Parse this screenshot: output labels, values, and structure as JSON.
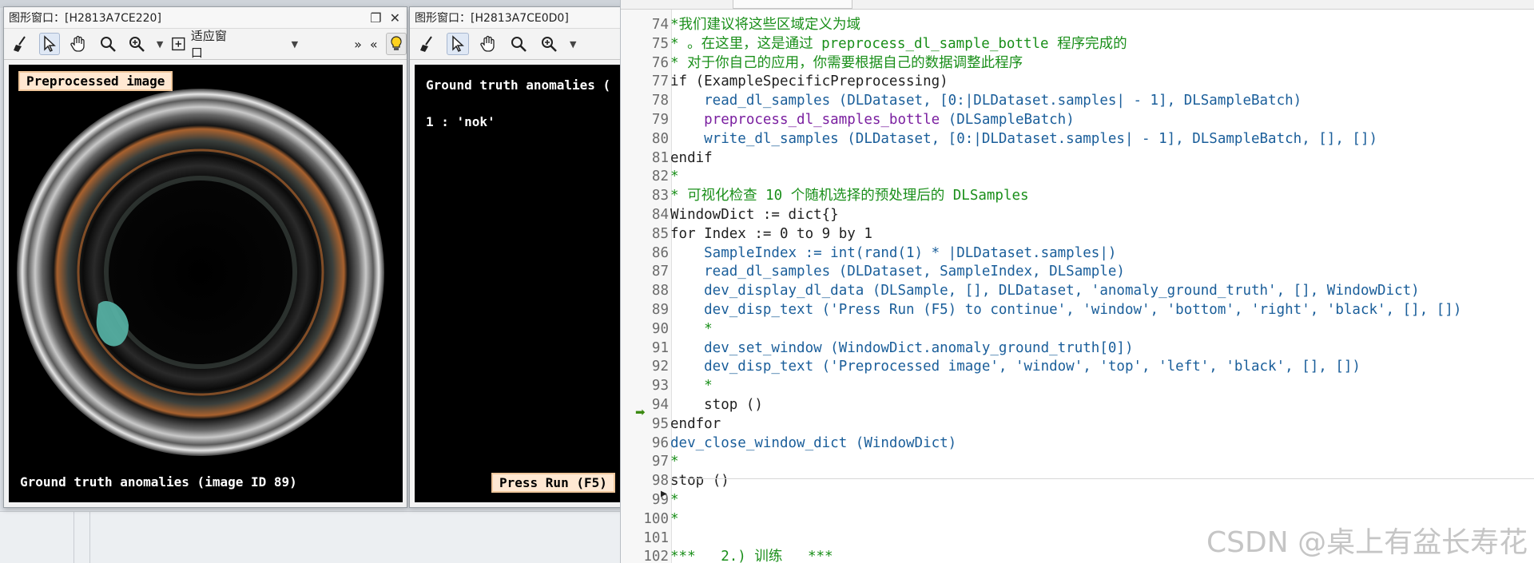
{
  "window_left": {
    "title": "图形窗口：[H2813A7CE220]",
    "fit_label": "适应窗口",
    "label_top": "Preprocessed image",
    "label_bottom": "Ground truth anomalies (image ID 89)"
  },
  "window_right": {
    "title": "图形窗口：[H2813A7CE0D0]",
    "header_text": "Ground truth anomalies (",
    "class_line": "1 : 'nok'",
    "press_label": "Press Run (F5)"
  },
  "editor": {
    "lines": [
      {
        "num": "74",
        "segments": [
          {
            "t": "*我们建议将这些区域定义为域",
            "c": "c-comment"
          }
        ]
      },
      {
        "num": "75",
        "segments": [
          {
            "t": "* 。在这里，这是通过 preprocess_dl_sample_bottle 程序完成的",
            "c": "c-comment"
          }
        ]
      },
      {
        "num": "76",
        "segments": [
          {
            "t": "* 对于你自己的应用，你需要根据自己的数据调整此程序",
            "c": "c-comment"
          }
        ]
      },
      {
        "num": "77",
        "segments": [
          {
            "t": "if (ExampleSpecificPreprocessing)",
            "c": "c-kw"
          }
        ]
      },
      {
        "num": "78",
        "segments": [
          {
            "t": "    read_dl_samples (DLDataset, [0:|DLDataset.samples| - 1], DLSampleBatch)",
            "c": "c-proc"
          }
        ]
      },
      {
        "num": "79",
        "segments": [
          {
            "t": "    preprocess_dl_samples_bottle ",
            "c": "c-ext"
          },
          {
            "t": "(DLSampleBatch)",
            "c": "c-proc"
          }
        ]
      },
      {
        "num": "80",
        "segments": [
          {
            "t": "    write_dl_samples (DLDataset, [0:|DLDataset.samples| - 1], DLSampleBatch, [], [])",
            "c": "c-proc"
          }
        ]
      },
      {
        "num": "81",
        "segments": [
          {
            "t": "endif",
            "c": "c-kw"
          }
        ]
      },
      {
        "num": "82",
        "segments": [
          {
            "t": "*",
            "c": "c-comment"
          }
        ]
      },
      {
        "num": "83",
        "segments": [
          {
            "t": "* 可视化检查 10 个随机选择的预处理后的 DLSamples",
            "c": "c-comment"
          }
        ]
      },
      {
        "num": "84",
        "segments": [
          {
            "t": "WindowDict := dict{}",
            "c": "c-kw"
          }
        ]
      },
      {
        "num": "85",
        "segments": [
          {
            "t": "for Index := 0 to 9 by 1",
            "c": "c-kw"
          }
        ]
      },
      {
        "num": "86",
        "segments": [
          {
            "t": "    SampleIndex := int(rand(1) * |DLDataset.samples|)",
            "c": "c-proc"
          }
        ]
      },
      {
        "num": "87",
        "segments": [
          {
            "t": "    read_dl_samples (DLDataset, SampleIndex, DLSample)",
            "c": "c-proc"
          }
        ]
      },
      {
        "num": "88",
        "segments": [
          {
            "t": "    dev_display_dl_data (DLSample, [], DLDataset, 'anomaly_ground_truth', [], WindowDict)",
            "c": "c-proc"
          }
        ]
      },
      {
        "num": "89",
        "segments": [
          {
            "t": "    dev_disp_text ('Press Run (F5) to continue', 'window', 'bottom', 'right', 'black', [], [])",
            "c": "c-proc"
          }
        ]
      },
      {
        "num": "90",
        "segments": [
          {
            "t": "    *",
            "c": "c-comment"
          }
        ]
      },
      {
        "num": "91",
        "segments": [
          {
            "t": "    dev_set_window (WindowDict.anomaly_ground_truth[0])",
            "c": "c-proc"
          }
        ]
      },
      {
        "num": "92",
        "segments": [
          {
            "t": "    dev_disp_text ('Preprocessed image', 'window', 'top', 'left', 'black', [], [])",
            "c": "c-proc"
          }
        ]
      },
      {
        "num": "93",
        "segments": [
          {
            "t": "    *",
            "c": "c-comment"
          }
        ]
      },
      {
        "num": "94",
        "segments": [
          {
            "t": "    stop ()",
            "c": "c-kw"
          }
        ]
      },
      {
        "num": "95",
        "segments": [
          {
            "t": "endfor",
            "c": "c-kw"
          }
        ]
      },
      {
        "num": "96",
        "segments": [
          {
            "t": "dev_close_window_dict (WindowDict)",
            "c": "c-proc"
          }
        ]
      },
      {
        "num": "97",
        "segments": [
          {
            "t": "*",
            "c": "c-comment"
          }
        ]
      },
      {
        "num": "98",
        "segments": [
          {
            "t": "stop ",
            "c": "c-kw"
          },
          {
            "t": "()",
            "c": "c-kw"
          }
        ]
      },
      {
        "num": "99",
        "segments": [
          {
            "t": "*",
            "c": "c-comment"
          }
        ]
      },
      {
        "num": "100",
        "segments": [
          {
            "t": "*",
            "c": "c-comment"
          }
        ]
      },
      {
        "num": "101",
        "segments": [
          {
            "t": "",
            "c": "c-kw"
          }
        ]
      },
      {
        "num": "102",
        "segments": [
          {
            "t": "***   2.) 训练   ***",
            "c": "c-comment"
          }
        ]
      }
    ]
  },
  "watermark": "CSDN @桌上有盆长寿花"
}
